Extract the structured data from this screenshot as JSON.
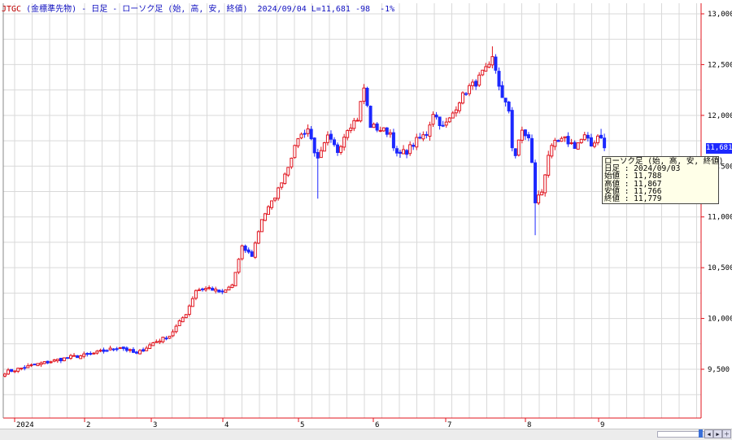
{
  "header": {
    "symbol": "JTGC",
    "title": "(金標準先物) - 日足 - ローソク足 (始, 高, 安, 終値)",
    "date": "2024/09/04",
    "last": "L=11,681",
    "change": "-98",
    "change_pct": "-1%"
  },
  "price_tag": "11,681",
  "tooltip": {
    "lines": [
      "ローソク足 (始, 高, 安, 終値)",
      "日足 : 2024/09/03",
      "始値 : 11,788",
      "高値 : 11,867",
      "安値 : 11,766",
      "終値 : 11,779"
    ]
  },
  "nav": {
    "left": "◀",
    "right": "▶",
    "zoom_out": "－",
    "zoom_in": "＋"
  },
  "colors": {
    "up": "#e0141e",
    "down": "#1c28ff",
    "grid": "#d9d9d9",
    "axis": "#e0141e",
    "bg": "#ffffff"
  },
  "chart_data": {
    "type": "candlestick",
    "yaxis": {
      "ticks": [
        9500,
        10000,
        10500,
        11000,
        11500,
        12000,
        12500,
        13000
      ],
      "tick_labels": [
        "9,500",
        "10,000",
        "10,500",
        "11,000",
        "11,500",
        "12,000",
        "12,500",
        "13,000"
      ],
      "ylim": [
        9100,
        13050
      ],
      "position": "right"
    },
    "xaxis": {
      "labels": [
        "2024",
        "2",
        "3",
        "4",
        "5",
        "6",
        "7",
        "8",
        "9"
      ]
    },
    "grid": true,
    "anchors": [
      [
        0,
        9470
      ],
      [
        10,
        9550
      ],
      [
        20,
        9620
      ],
      [
        25,
        9640
      ],
      [
        30,
        9680
      ],
      [
        35,
        9720
      ],
      [
        40,
        9650
      ],
      [
        45,
        9760
      ],
      [
        50,
        9830
      ],
      [
        55,
        10050
      ],
      [
        58,
        10280
      ],
      [
        62,
        10300
      ],
      [
        66,
        10250
      ],
      [
        69,
        10330
      ],
      [
        72,
        10700
      ],
      [
        75,
        10620
      ],
      [
        78,
        10980
      ],
      [
        82,
        11200
      ],
      [
        86,
        11500
      ],
      [
        89,
        11780
      ],
      [
        92,
        11870
      ],
      [
        95,
        11550
      ],
      [
        98,
        11780
      ],
      [
        101,
        11650
      ],
      [
        104,
        11880
      ],
      [
        107,
        11970
      ],
      [
        109,
        12270
      ],
      [
        111,
        11900
      ],
      [
        114,
        11860
      ],
      [
        117,
        11830
      ],
      [
        119,
        11600
      ],
      [
        122,
        11650
      ],
      [
        125,
        11750
      ],
      [
        128,
        11820
      ],
      [
        130,
        12030
      ],
      [
        133,
        11880
      ],
      [
        135,
        11960
      ],
      [
        138,
        12150
      ],
      [
        141,
        12280
      ],
      [
        143,
        12320
      ],
      [
        145,
        12420
      ],
      [
        147,
        12470
      ],
      [
        148,
        12560
      ],
      [
        149,
        12450
      ],
      [
        151,
        12160
      ],
      [
        153,
        12050
      ],
      [
        154,
        11700
      ],
      [
        155,
        11610
      ],
      [
        157,
        11850
      ],
      [
        159,
        11770
      ],
      [
        160,
        11520
      ],
      [
        161,
        11150
      ],
      [
        163,
        11250
      ],
      [
        165,
        11620
      ],
      [
        167,
        11720
      ],
      [
        170,
        11760
      ],
      [
        173,
        11700
      ],
      [
        176,
        11790
      ],
      [
        178,
        11700
      ],
      [
        180,
        11800
      ],
      [
        181,
        11788
      ],
      [
        182,
        11681
      ]
    ],
    "total_bars": 183
  }
}
